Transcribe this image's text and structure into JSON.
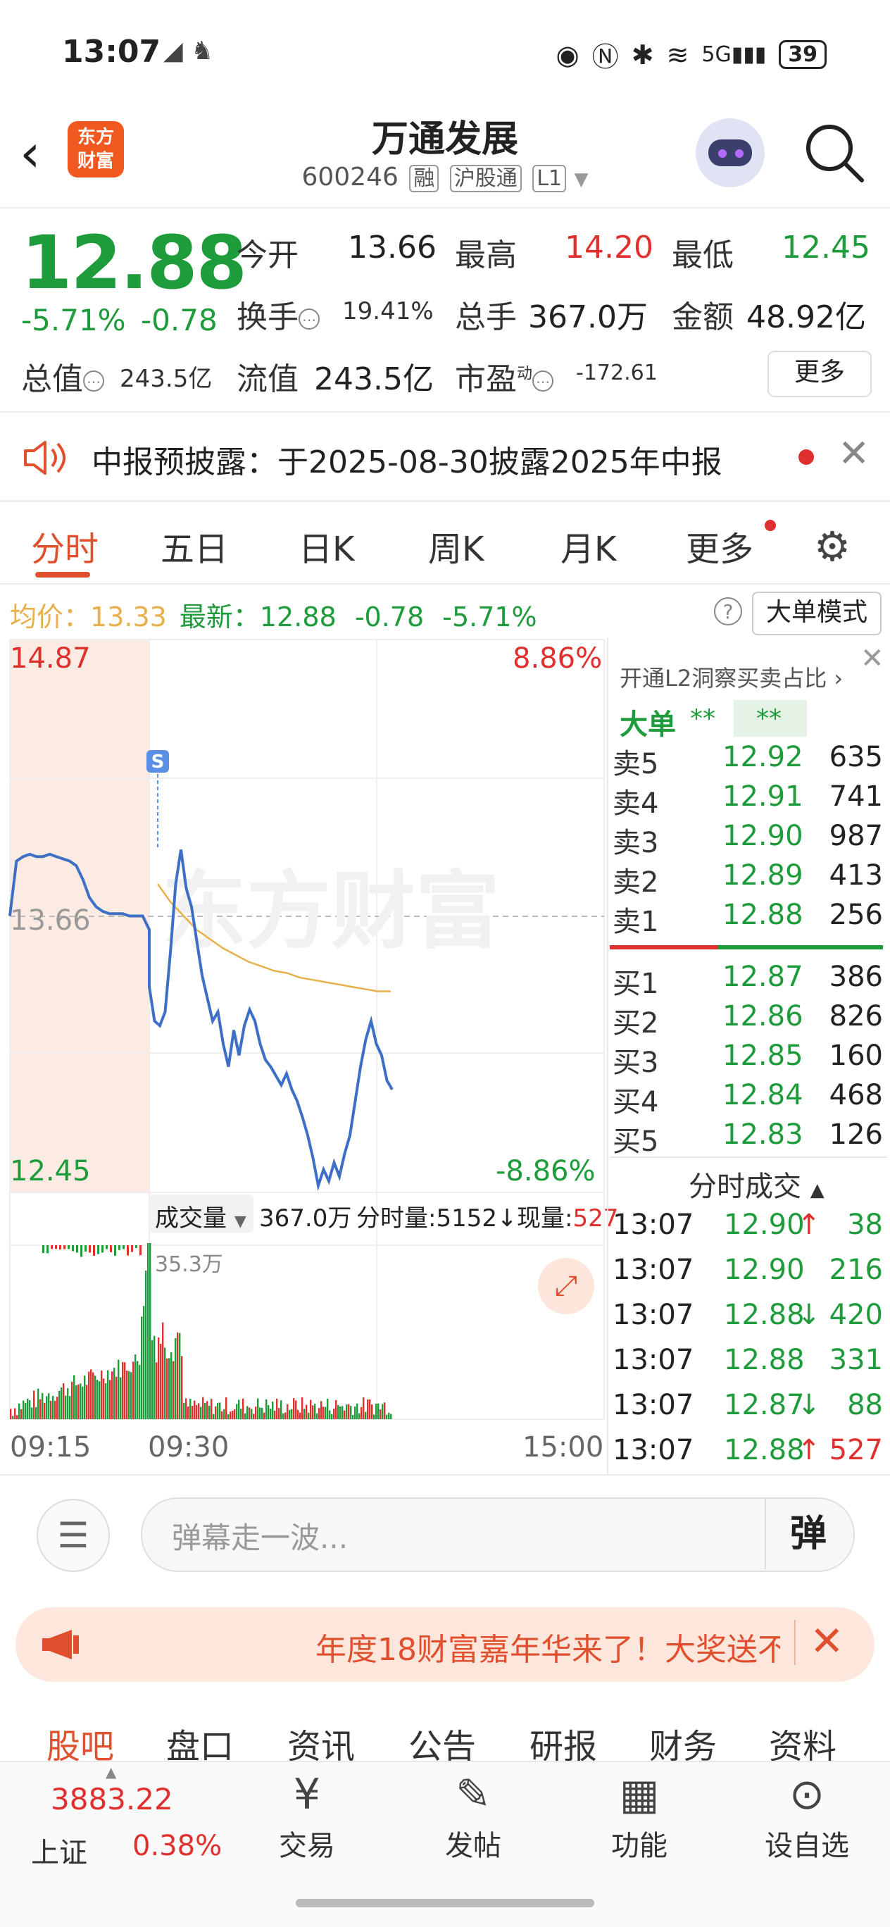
{
  "status_bar": {
    "time": "13:07",
    "battery": "39"
  },
  "header": {
    "logo_line1": "东方",
    "logo_line2": "财富",
    "title": "万通发展",
    "code": "600246",
    "tags": [
      "融",
      "沪股通",
      "L1"
    ]
  },
  "quote": {
    "price": "12.88",
    "change_pct": "-5.71%",
    "change_abs": "-0.78",
    "stats": {
      "open_label": "今开",
      "open": "13.66",
      "high_label": "最高",
      "high": "14.20",
      "low_label": "最低",
      "low": "12.45",
      "turnover_label": "换手",
      "turnover": "19.41%",
      "volume_label": "总手",
      "volume": "367.0万",
      "amount_label": "金额",
      "amount": "48.92亿",
      "mktcap_label": "总值",
      "mktcap": "243.5亿",
      "float_label": "流值",
      "float": "243.5亿",
      "pe_label": "市盈",
      "pe_sup": "动",
      "pe": "-172.61"
    },
    "more_label": "更多"
  },
  "notice": {
    "text": "中报预披露：于2025-08-30披露2025年中报"
  },
  "tabs": [
    "分时",
    "五日",
    "日K",
    "周K",
    "月K",
    "更多"
  ],
  "avg_line": {
    "avg_label": "均价：",
    "avg": "13.33",
    "latest_label": "最新：",
    "latest": "12.88",
    "chg": "-0.78",
    "pct": "-5.71%",
    "mode_button": "大单模式"
  },
  "chart_labels": {
    "y_top": "14.87",
    "y_mid": "13.66",
    "y_bottom": "12.45",
    "pct_top": "8.86%",
    "pct_bottom": "-8.86%",
    "signal": "S",
    "watermark": "东方财富",
    "vol_selector": "成交量",
    "vol_total": "367.0万",
    "min_vol": "分时量:5152",
    "cur_vol_label": "现量:",
    "cur_vol": "527",
    "vol_peak": "35.3万",
    "t_start": "09:15",
    "t_open": "09:30",
    "t_end": "15:00"
  },
  "chart_data": [
    {
      "type": "line",
      "title": "分时",
      "ylim": [
        12.45,
        14.87
      ],
      "series": [
        {
          "name": "price",
          "color": "#3d6fc6",
          "values": [
            13.66,
            13.9,
            13.92,
            13.93,
            13.92,
            13.92,
            13.93,
            13.92,
            13.91,
            13.9,
            13.88,
            13.82,
            13.74,
            13.7,
            13.68,
            13.67,
            13.67,
            13.67,
            13.66,
            13.66,
            13.66,
            13.6,
            13.35,
            13.2,
            13.18,
            13.24,
            13.5,
            13.8,
            13.95,
            13.78,
            13.7,
            13.55,
            13.4,
            13.3,
            13.2,
            13.24,
            13.1,
            13.0,
            13.16,
            13.05,
            13.18,
            13.25,
            13.2,
            13.1,
            13.03,
            13.0,
            12.96,
            12.92,
            12.97,
            12.9,
            12.85,
            12.78,
            12.7,
            12.6,
            12.48,
            12.55,
            12.5,
            12.58,
            12.52,
            12.62,
            12.7,
            12.85,
            13.0,
            13.12,
            13.2,
            13.1,
            13.05,
            12.94,
            12.9
          ]
        },
        {
          "name": "avg",
          "color": "#e8b04a",
          "values": [
            13.8,
            13.72,
            13.66,
            13.6,
            13.56,
            13.52,
            13.49,
            13.46,
            13.44,
            13.42,
            13.41,
            13.39,
            13.38,
            13.37,
            13.36,
            13.35,
            13.34,
            13.33,
            13.33
          ]
        }
      ]
    },
    {
      "type": "bar",
      "title": "成交量",
      "peak": "35.3万"
    }
  ],
  "order_book": {
    "header": "开通L2洞察买卖占比",
    "big_label": "大单",
    "big_val1": "**",
    "big_val2": "**",
    "asks": [
      {
        "label": "卖5",
        "price": "12.92",
        "vol": "635"
      },
      {
        "label": "卖4",
        "price": "12.91",
        "vol": "741"
      },
      {
        "label": "卖3",
        "price": "12.90",
        "vol": "987"
      },
      {
        "label": "卖2",
        "price": "12.89",
        "vol": "413"
      },
      {
        "label": "卖1",
        "price": "12.88",
        "vol": "256"
      }
    ],
    "bids": [
      {
        "label": "买1",
        "price": "12.87",
        "vol": "386"
      },
      {
        "label": "买2",
        "price": "12.86",
        "vol": "826"
      },
      {
        "label": "买3",
        "price": "12.85",
        "vol": "160"
      },
      {
        "label": "买4",
        "price": "12.84",
        "vol": "468"
      },
      {
        "label": "买5",
        "price": "12.83",
        "vol": "126"
      }
    ],
    "ticks_header": "分时成交",
    "ticks": [
      {
        "time": "13:07",
        "price": "12.90",
        "arrow": "↑",
        "vol": "38"
      },
      {
        "time": "13:07",
        "price": "12.90",
        "arrow": "",
        "vol": "216"
      },
      {
        "time": "13:07",
        "price": "12.88",
        "arrow": "↓",
        "vol": "420"
      },
      {
        "time": "13:07",
        "price": "12.88",
        "arrow": "",
        "vol": "331"
      },
      {
        "time": "13:07",
        "price": "12.87",
        "arrow": "↓",
        "vol": "88"
      },
      {
        "time": "13:07",
        "price": "12.88",
        "arrow": "↑",
        "vol": "527"
      }
    ]
  },
  "comment": {
    "placeholder": "弹幕走一波...",
    "button": "弹"
  },
  "banner": {
    "text": "年度18财富嘉年华来了！大奖送不"
  },
  "subtabs": [
    "股吧",
    "盘口",
    "资讯",
    "公告",
    "研报",
    "财务",
    "资料"
  ],
  "bottom_nav": {
    "index_value": "3883.22",
    "index_name": "上证",
    "index_pct": "0.38%",
    "items": [
      {
        "label": "交易",
        "icon": "yen-refresh-icon"
      },
      {
        "label": "发帖",
        "icon": "edit-icon"
      },
      {
        "label": "功能",
        "icon": "grid-icon"
      },
      {
        "label": "设自选",
        "icon": "more-circle-icon"
      }
    ]
  }
}
